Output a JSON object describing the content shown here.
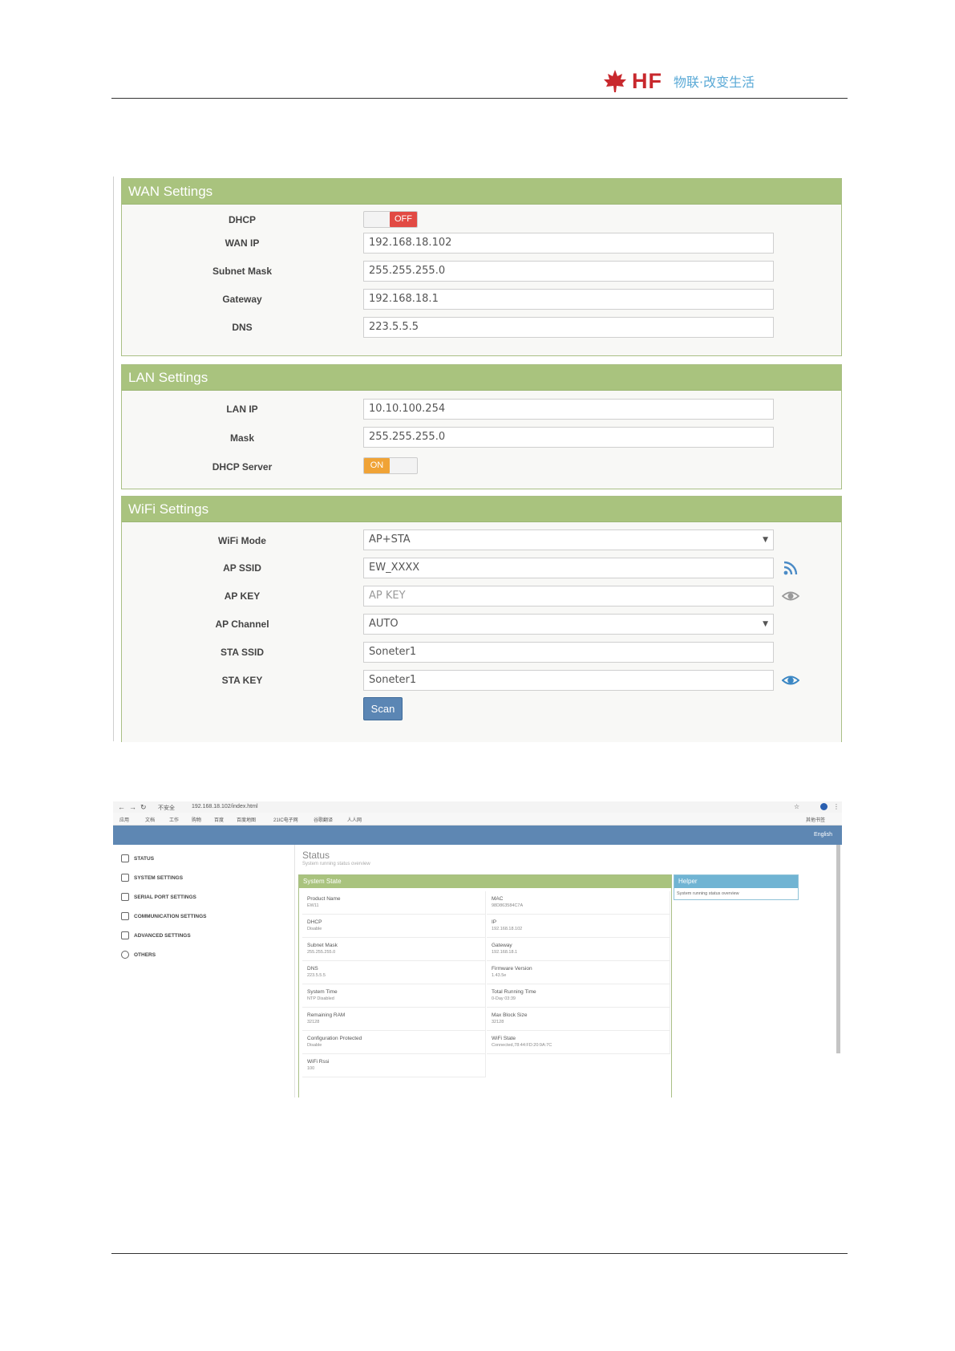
{
  "doc_header": {
    "logo_text": "HF",
    "slogan": "物联·改变生活"
  },
  "wan": {
    "title": "WAN Settings",
    "dhcp_label": "DHCP",
    "dhcp_state": "OFF",
    "wan_ip_label": "WAN IP",
    "wan_ip": "192.168.18.102",
    "subnet_label": "Subnet Mask",
    "subnet": "255.255.255.0",
    "gateway_label": "Gateway",
    "gateway": "192.168.18.1",
    "dns_label": "DNS",
    "dns": "223.5.5.5"
  },
  "lan": {
    "title": "LAN Settings",
    "lan_ip_label": "LAN IP",
    "lan_ip": "10.10.100.254",
    "mask_label": "Mask",
    "mask": "255.255.255.0",
    "dhcp_server_label": "DHCP Server",
    "dhcp_server_state": "ON"
  },
  "wifi": {
    "title": "WiFi Settings",
    "mode_label": "WiFi Mode",
    "mode": "AP+STA",
    "ap_ssid_label": "AP SSID",
    "ap_ssid": "EW_XXXX",
    "ap_key_label": "AP KEY",
    "ap_key_placeholder": "AP KEY",
    "ap_channel_label": "AP Channel",
    "ap_channel": "AUTO",
    "sta_ssid_label": "STA SSID",
    "sta_ssid": "Soneter1",
    "sta_key_label": "STA KEY",
    "sta_key": "Soneter1",
    "scan_label": "Scan"
  },
  "status_page": {
    "url": "192.168.18.102/index.html",
    "insecure_label": "不安全",
    "bookmarks": [
      "应用",
      "文档",
      "工作",
      "购物",
      "百度",
      "百度地图",
      "21IC电子网",
      "谷歌翻译",
      "人人网"
    ],
    "other_bookmarks": "其他书签",
    "language": "English",
    "nav": [
      "STATUS",
      "SYSTEM SETTINGS",
      "SERIAL PORT SETTINGS",
      "COMMUNICATION SETTINGS",
      "ADVANCED SETTINGS",
      "OTHERS"
    ],
    "title": "Status",
    "subtitle": "System running status overview",
    "panel_title": "System State",
    "fields": [
      {
        "k": "Product Name",
        "v": "EW11"
      },
      {
        "k": "MAC",
        "v": "98D863584C7A"
      },
      {
        "k": "DHCP",
        "v": "Disable"
      },
      {
        "k": "IP",
        "v": "192.168.18.102"
      },
      {
        "k": "Subnet Mask",
        "v": "255.255.255.0"
      },
      {
        "k": "Gateway",
        "v": "192.168.18.1"
      },
      {
        "k": "DNS",
        "v": "223.5.5.5"
      },
      {
        "k": "Firmware Version",
        "v": "1.43.5e"
      },
      {
        "k": "System Time",
        "v": "NTP Disabled"
      },
      {
        "k": "Total Running Time",
        "v": "0-Day 03:39"
      },
      {
        "k": "Remaining RAM",
        "v": "32128"
      },
      {
        "k": "Max Block Size",
        "v": "32128"
      },
      {
        "k": "Configuration Protected",
        "v": "Disable"
      },
      {
        "k": "WiFi State",
        "v": "Connected,78:44:FD:20:9A:7C"
      },
      {
        "k": "WiFi Rssi",
        "v": "100"
      }
    ],
    "helper_title": "Helper",
    "helper_text": "System running status overview"
  }
}
